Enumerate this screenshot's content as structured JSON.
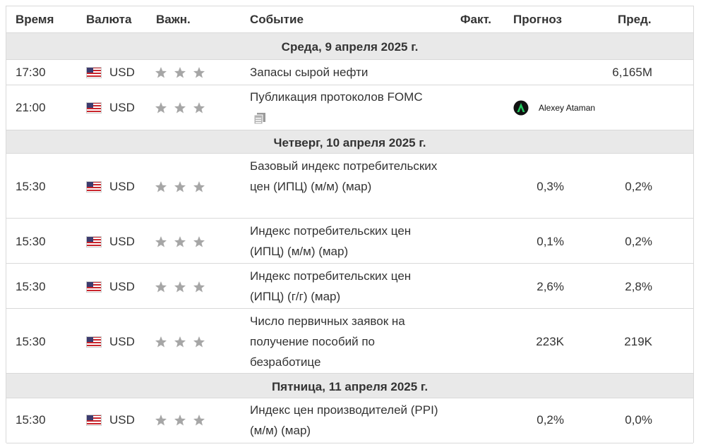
{
  "header": {
    "time": "Время",
    "currency": "Валюта",
    "importance": "Важн.",
    "event": "Событие",
    "actual": "Факт.",
    "forecast": "Прогноз",
    "previous": "Пред."
  },
  "days": [
    {
      "label": "Среда, 9 апреля 2025 г."
    },
    {
      "label": "Четверг, 10 апреля 2025 г."
    },
    {
      "label": "Пятница, 11 апреля 2025 г."
    }
  ],
  "events": [
    {
      "time": "17:30",
      "currency": "USD",
      "importance_stars": 3,
      "event": "Запасы сырой нефти",
      "actual": "",
      "forecast": "",
      "previous": "6,165M"
    },
    {
      "time": "21:00",
      "currency": "USD",
      "importance_stars": 3,
      "event": "Публикация протоколов FOMC",
      "actual": "",
      "forecast": "",
      "previous": ""
    },
    {
      "time": "15:30",
      "currency": "USD",
      "importance_stars": 3,
      "event": "Базовый индекс потребительских цен (ИПЦ) (м/м) (мар)",
      "actual": "",
      "forecast": "0,3%",
      "previous": "0,2%"
    },
    {
      "time": "15:30",
      "currency": "USD",
      "importance_stars": 3,
      "event": "Индекс потребительских цен (ИПЦ) (м/м) (мар)",
      "actual": "",
      "forecast": "0,1%",
      "previous": "0,2%"
    },
    {
      "time": "15:30",
      "currency": "USD",
      "importance_stars": 3,
      "event": "Индекс потребительских цен (ИПЦ) (г/г) (мар)",
      "actual": "",
      "forecast": "2,6%",
      "previous": "2,8%"
    },
    {
      "time": "15:30",
      "currency": "USD",
      "importance_stars": 3,
      "event": "Число первичных заявок на получение пособий по безработице",
      "actual": "",
      "forecast": "223K",
      "previous": "219K"
    },
    {
      "time": "15:30",
      "currency": "USD",
      "importance_stars": 3,
      "event": "Индекс цен производителей (PPI) (м/м) (мар)",
      "actual": "",
      "forecast": "0,2%",
      "previous": "0,0%"
    }
  ],
  "watermark": {
    "text": "Alexey Ataman"
  },
  "icons": {
    "flag": "us-flag-icon",
    "star": "star-icon",
    "doc": "document-icon",
    "logo": "logo-icon"
  },
  "colors": {
    "star": "#a6a6a6",
    "day_bg": "#e9e9e9",
    "border": "#d9d9d9"
  }
}
